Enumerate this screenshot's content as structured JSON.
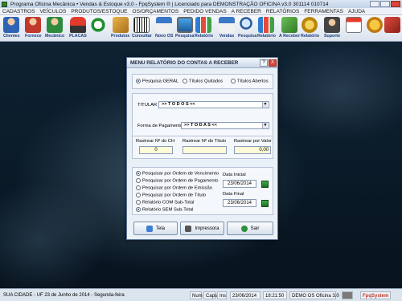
{
  "window": {
    "title": "Programa Oficina Mecânica • Vendas & Estoque v3.0 - FpqSystem ® | Licenciado para DEMONSTRAÇÃO OFICINA v3.0 301114 010714"
  },
  "menubar": [
    "CADASTROS",
    "VEÍCULOS",
    "PRODUTOS/ESTOQUE",
    "OS/ORÇAMENTOS",
    "PEDIDO VENDAS",
    "A RECEBER",
    "RELATÓRIOS",
    "FERRAMENTAS",
    "AJUDA"
  ],
  "toolbar": [
    {
      "label": "Clientes",
      "icon": "people-icon"
    },
    {
      "label": "Fornece",
      "icon": "people-icon"
    },
    {
      "label": "Mecânico",
      "icon": "people-icon"
    },
    {
      "label": "PLACAS",
      "icon": "car-icon"
    },
    {
      "label": "",
      "icon": "clock-icon"
    },
    {
      "label": "Produtos",
      "icon": "box-icon"
    },
    {
      "label": "Consultar",
      "icon": "barcode-icon"
    },
    {
      "label": "Novo OS",
      "icon": "shop-icon"
    },
    {
      "label": "Pesquisa",
      "icon": "monitor-icon"
    },
    {
      "label": "Relatório",
      "icon": "chart-icon"
    },
    {
      "label": "Vendas",
      "icon": "shop-icon"
    },
    {
      "label": "Pesquisa",
      "icon": "lens-icon"
    },
    {
      "label": "Relatório",
      "icon": "chart-icon"
    },
    {
      "label": "A Receber",
      "icon": "money-icon"
    },
    {
      "label": "Relatório",
      "icon": "coins-icon"
    },
    {
      "label": "Suporte",
      "icon": "support-icon"
    },
    {
      "label": "",
      "icon": "calendar-icon"
    },
    {
      "label": "",
      "icon": "gold-icon"
    },
    {
      "label": "",
      "icon": "exit-icon"
    }
  ],
  "dialog": {
    "title": "MENU RELATÓRIO DO CONTAS A RECEBER",
    "help": "?",
    "close": "X",
    "search_type": [
      "Pesquisa GERAL",
      "Títulos Quitados",
      "Títulos Abertos"
    ],
    "titular_label": "TITULAR",
    "titular_value": ">> T O D O S <<",
    "forma_label": "Forma de Pagamento",
    "forma_value": ">> T O D A S <<",
    "rastrear": [
      {
        "label": "Rastrear Nº do CH",
        "value": "0"
      },
      {
        "label": "Rastrear Nº do Título",
        "value": ""
      },
      {
        "label": "Rastrear por Valor",
        "value": "0,00"
      }
    ],
    "order_options": [
      {
        "label": "Pesquisar por Ordem de Vencimento",
        "selected": true
      },
      {
        "label": "Pesquisar por Ordem de Pagamento",
        "selected": false
      },
      {
        "label": "Pesquisar por Ordem de Emissão",
        "selected": false
      },
      {
        "label": "Pesquisar por Ordem de Título",
        "selected": false
      },
      {
        "label": "Relatório COM Sub-Total",
        "selected": false
      },
      {
        "label": "Relatório SEM Sub-Total",
        "selected": true
      }
    ],
    "data_inicial_label": "Data Inicial",
    "data_inicial": "23/06/2014",
    "data_final_label": "Data Final",
    "data_final": "23/06/2014",
    "buttons": {
      "tela": "Tela",
      "impressora": "Impressora",
      "sair": "Sair"
    }
  },
  "statusbar": {
    "city": "SUA CIDADE - UF 23 de Junho de 2014 - Segunda-feira",
    "num": "Num",
    "caps": "Caps",
    "ins": "Ins",
    "date": "23/06/2014",
    "time": "18:21:50",
    "demo": "DEMO OS Oficina 3.0",
    "brand": "FpqSystem"
  },
  "colors": {
    "accent": "#1d3b7a",
    "field_bg": "#fefbd8",
    "close": "#d9453b"
  }
}
